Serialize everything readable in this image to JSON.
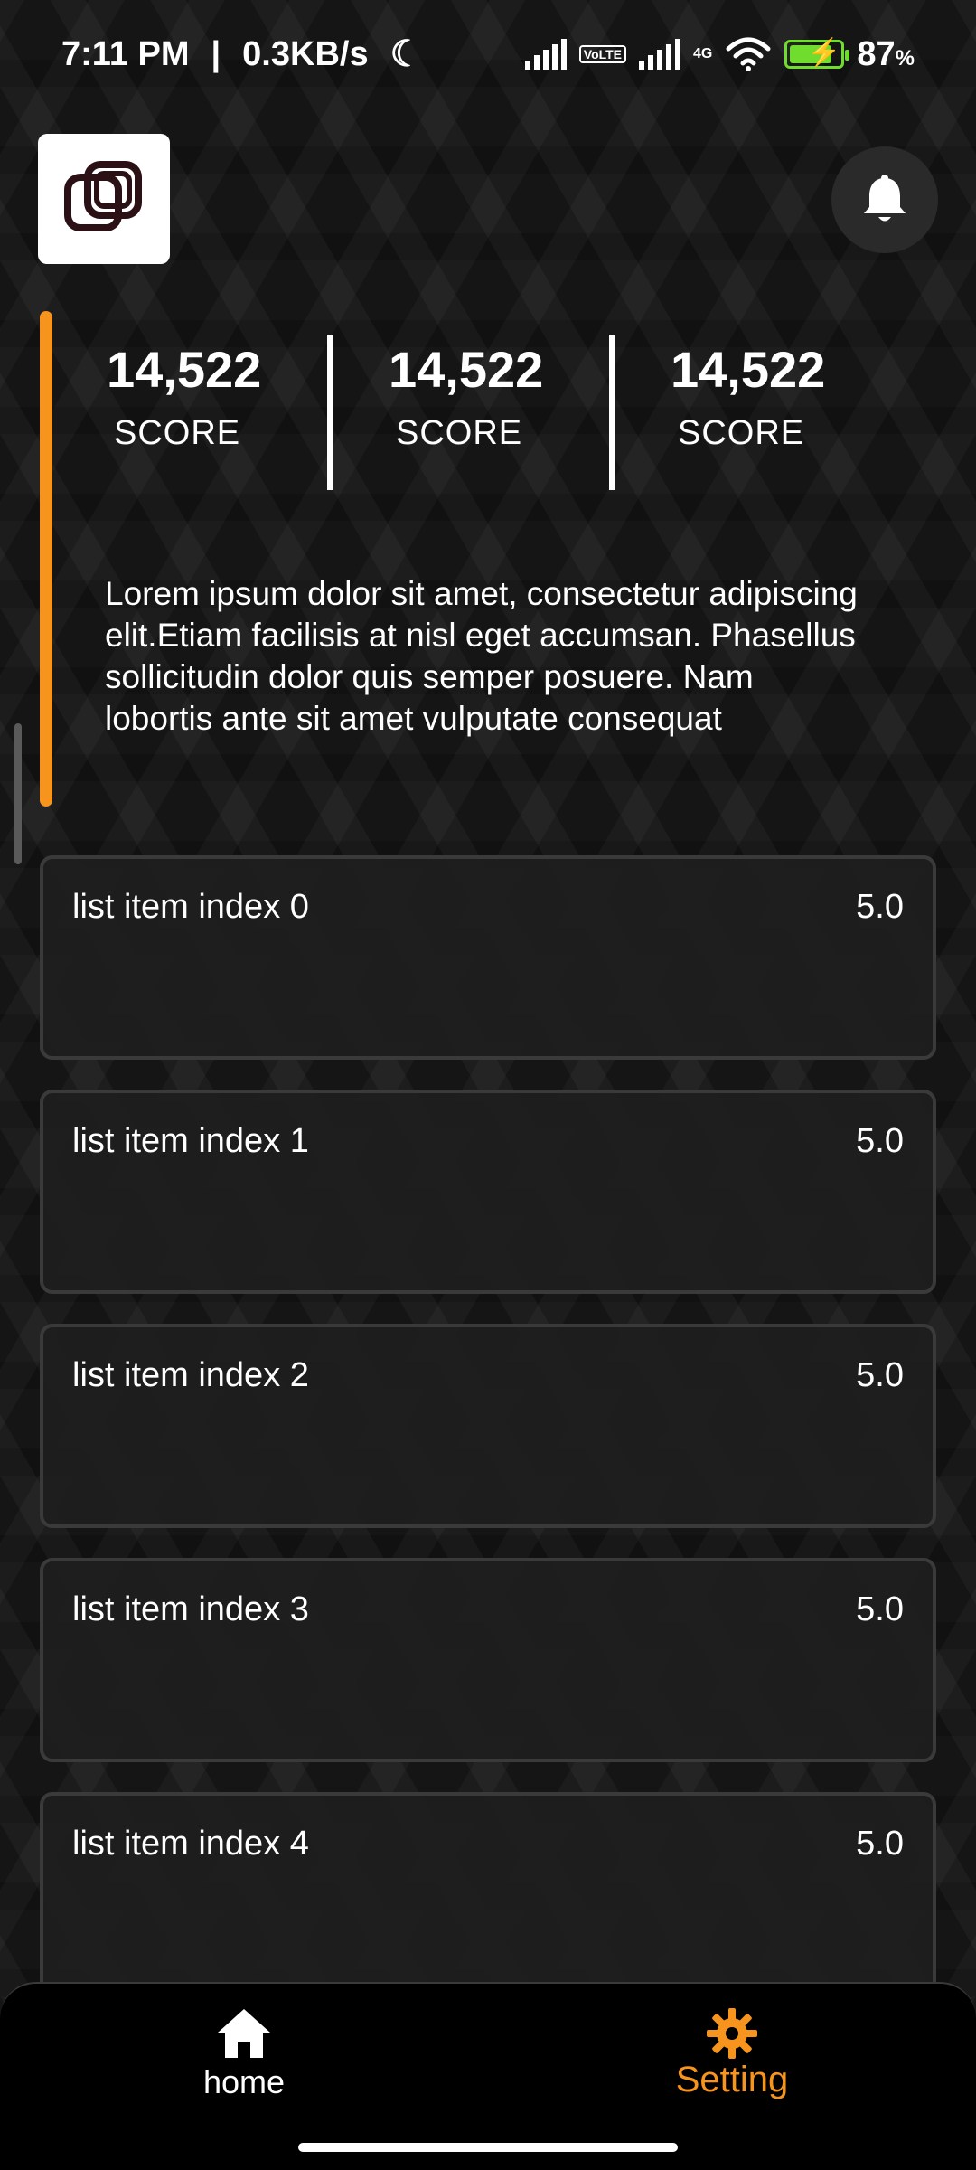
{
  "status_bar": {
    "time": "7:11  PM",
    "separator": "|",
    "net_speed": "0.3KB/s",
    "sim1_label": "VoLTE",
    "sim2_label": "4G",
    "battery": "87",
    "battery_unit": "%",
    "battery_level": 0.87
  },
  "header": {
    "logo_icon": "app-logo-icon",
    "bell_icon": "bell-icon"
  },
  "stats": [
    {
      "value": "14,522",
      "label": "SCORE"
    },
    {
      "value": "14,522",
      "label": "SCORE"
    },
    {
      "value": "14,522",
      "label": "SCORE"
    }
  ],
  "description": "Lorem ipsum dolor sit amet, consectetur adipiscing elit.Etiam facilisis at nisl eget accumsan. Phasellus sollicitudin dolor quis semper posuere. Nam lobortis ante sit amet vulputate consequat",
  "list": [
    {
      "title": "list item index 0",
      "value": "5.0"
    },
    {
      "title": "list item index 1",
      "value": "5.0"
    },
    {
      "title": "list item index 2",
      "value": "5.0"
    },
    {
      "title": "list item index 3",
      "value": "5.0"
    },
    {
      "title": "list item index 4",
      "value": "5.0"
    }
  ],
  "nav": {
    "home_label": "home",
    "setting_label": "Setting",
    "home_icon": "home-icon",
    "setting_icon": "gear-icon"
  },
  "colors": {
    "accent": "#f7941d",
    "background": "#151515",
    "card_border": "#3a3a3a"
  }
}
